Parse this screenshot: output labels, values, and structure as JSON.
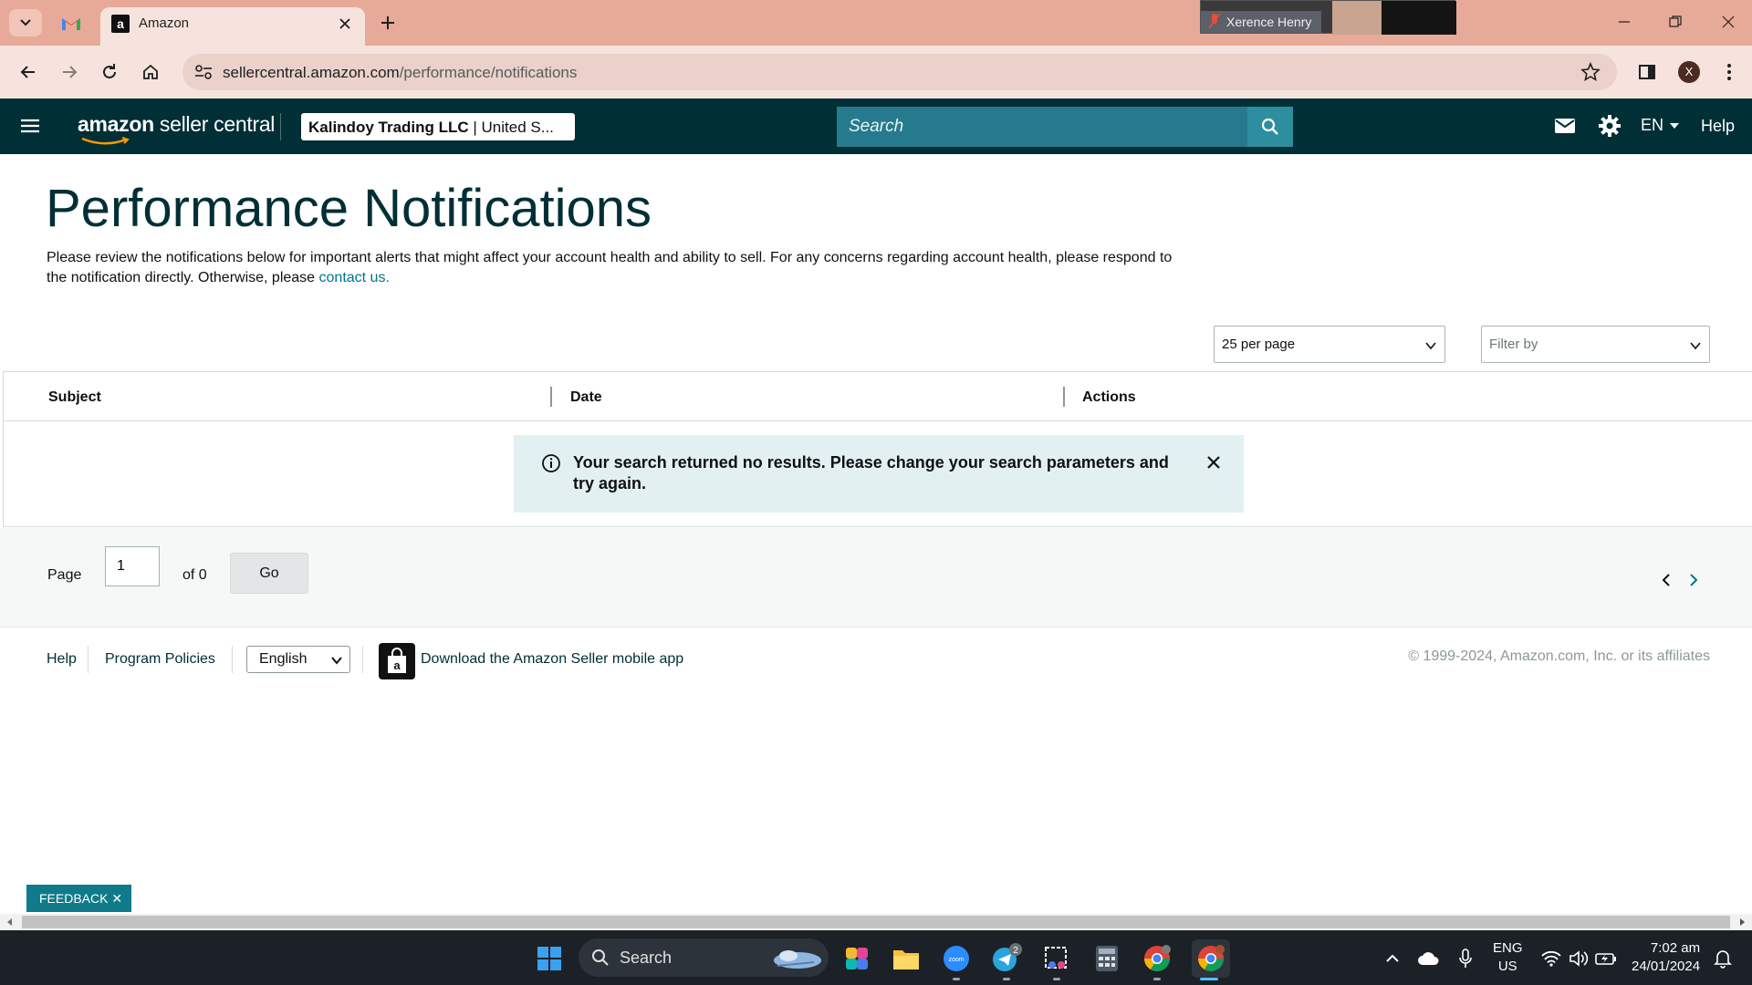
{
  "browser": {
    "tab_title": "Amazon",
    "url_host": "sellercentral.amazon.com",
    "url_path": "/performance/notifications",
    "profile_initial": "X",
    "video_participant": "Xerence Henry"
  },
  "header": {
    "brand_amazon": "amazon",
    "brand_rest": " seller central",
    "account_name": "Kalindoy Trading LLC",
    "account_region": " | United S...",
    "search_placeholder": "Search",
    "language": "EN",
    "help": "Help"
  },
  "page": {
    "title": "Performance Notifications",
    "intro_text": "Please review the notifications below for important alerts that might affect your account health and ability to sell. For any concerns regarding account health, please respond to the notification directly. Otherwise, please ",
    "intro_link": "contact us.",
    "per_page": "25 per page",
    "filter_placeholder": "Filter by"
  },
  "table": {
    "columns": [
      "Subject",
      "Date",
      "Actions"
    ],
    "rows": []
  },
  "alert": {
    "message": "Your search returned no results. Please change your search parameters and try again."
  },
  "pagination": {
    "page_label": "Page",
    "current_page": "1",
    "of_total": "of 0",
    "go_label": "Go"
  },
  "footer": {
    "help": "Help",
    "program_policies": "Program Policies",
    "language": "English",
    "app_link": "Download the Amazon Seller mobile app",
    "copyright": "© 1999-2024, Amazon.com, Inc. or its affiliates"
  },
  "feedback": {
    "label": "FEEDBACK ✕"
  },
  "taskbar": {
    "search_label": "Search",
    "telegram_badge": "2",
    "lang_top": "ENG",
    "lang_bottom": "US",
    "time": "7:02 am",
    "date": "24/01/2024"
  },
  "colors": {
    "header_bg": "#002f36",
    "search_bg": "#257b8d",
    "link": "#00758c",
    "alert_bg": "#e3f0f2",
    "feedback_bg": "#0f7a8a"
  }
}
